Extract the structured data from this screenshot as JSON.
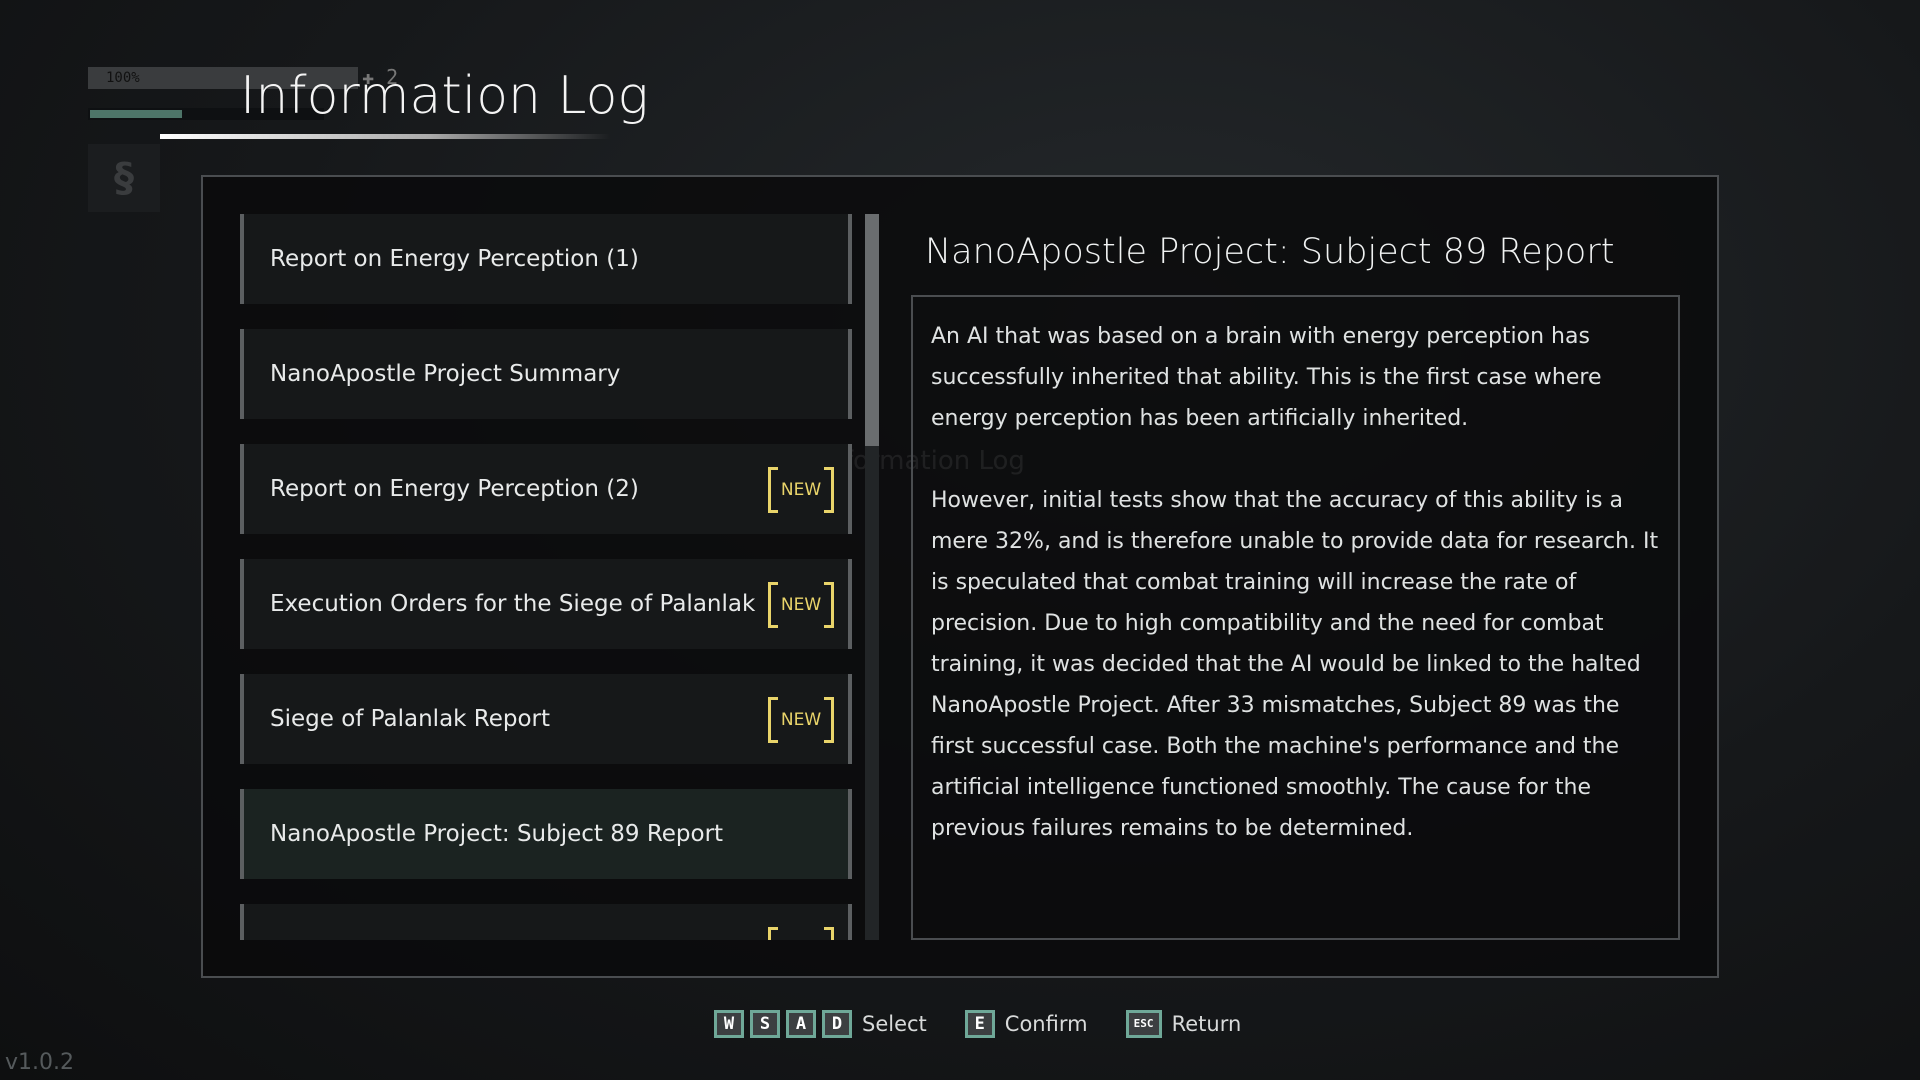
{
  "hud": {
    "health": "100%",
    "count": "2",
    "health_color": "#3a3c3e",
    "energy_fill": 0.39,
    "energy_color": "#4d7468",
    "icon": "emblem-icon"
  },
  "header": {
    "title": "Information Log"
  },
  "list": {
    "items": [
      {
        "label": "Report on Energy Perception (1)",
        "new": false
      },
      {
        "label": "NanoApostle Project Summary",
        "new": false
      },
      {
        "label": "Report on Energy Perception (2)",
        "new": true
      },
      {
        "label": "Execution Orders for the Siege of Palanlak",
        "new": true
      },
      {
        "label": "Siege of Palanlak Report",
        "new": true
      },
      {
        "label": "NanoApostle Project: Subject 89 Report",
        "new": false,
        "selected": true
      },
      {
        "label": "",
        "new": true
      }
    ],
    "new_label": "NEW",
    "new_color": "#e9d46a"
  },
  "ghost": {
    "key": "E",
    "label": "Information Log"
  },
  "detail": {
    "title": "NanoApostle Project: Subject 89 Report",
    "paragraphs": [
      "An AI that was based on a brain with energy perception has successfully inherited that ability. This is the first case where energy perception has been artificially inherited.",
      "However, initial tests show that the accuracy of this ability is a mere 32%, and is therefore unable to provide data for research. It is speculated that combat training will increase the rate of precision. Due to high compatibility and the need for combat training, it was decided that the AI would be linked to the halted NanoApostle Project. After 33 mismatches, Subject 89 was the first successful case. Both the machine's performance and the artificial intelligence functioned smoothly. The cause for the previous failures remains to be determined."
    ]
  },
  "footer": {
    "keys_select": [
      "W",
      "S",
      "A",
      "D"
    ],
    "select": "Select",
    "confirm_key": "E",
    "confirm": "Confirm",
    "return_key": "ESC",
    "return": "Return",
    "key_border_color": "#6fa898"
  },
  "version": "v1.0.2"
}
